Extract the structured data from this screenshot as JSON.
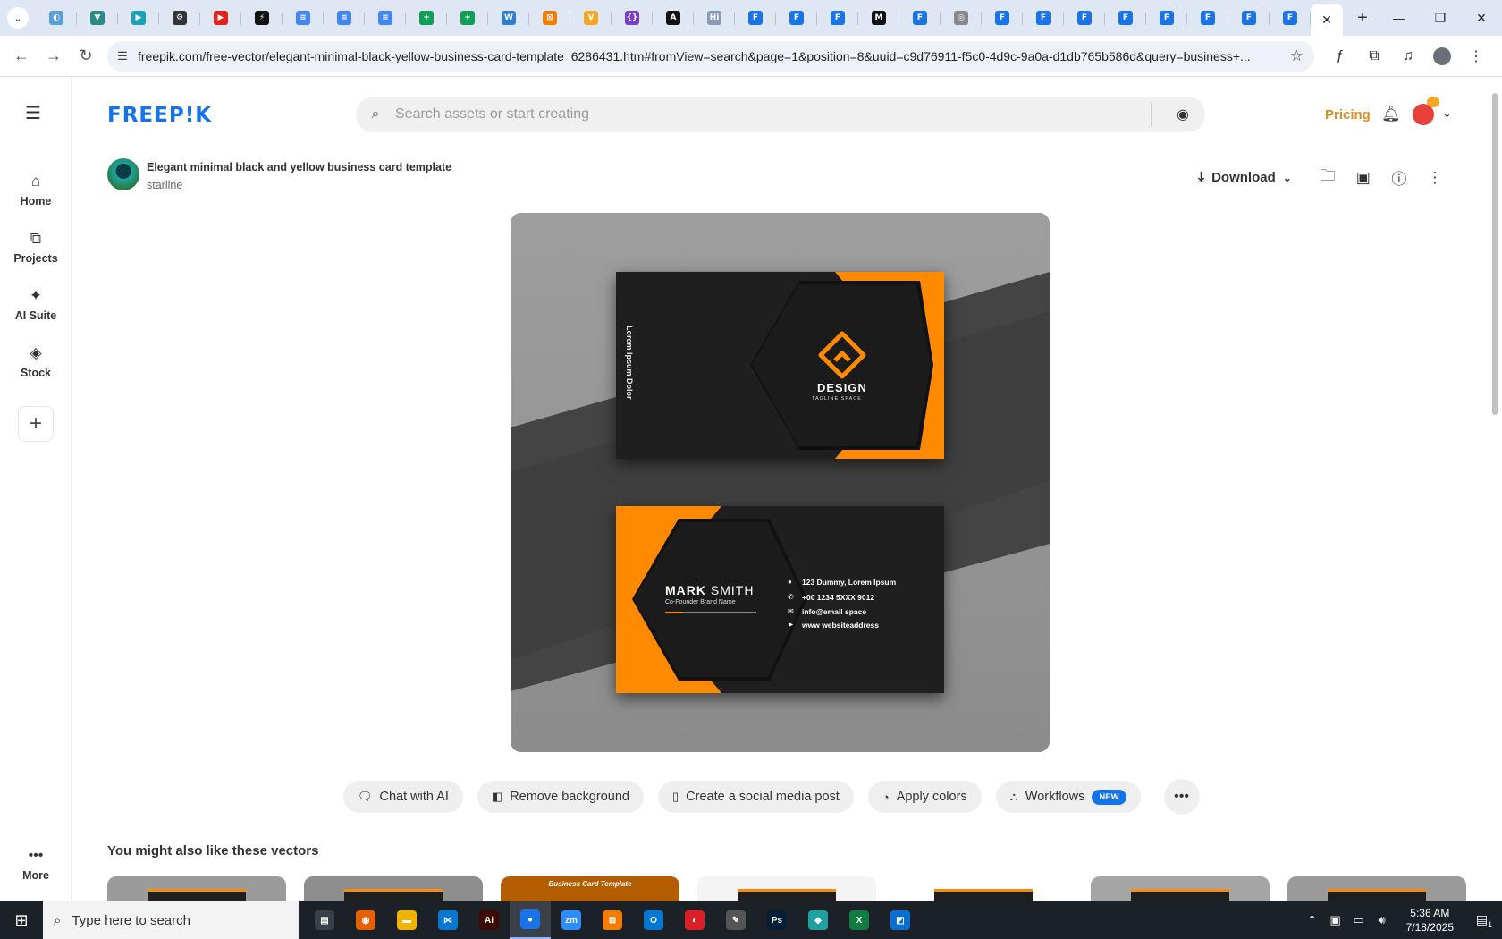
{
  "browser": {
    "tab_menu_icon": "chevron-down-icon",
    "tabs": [
      {
        "label": "",
        "color": "#5aa0d8",
        "glyph": "◐"
      },
      {
        "label": "",
        "color": "#2a8a86",
        "glyph": "▼"
      },
      {
        "label": "",
        "color": "#17a2b8",
        "glyph": "▶"
      },
      {
        "label": "",
        "color": "#333333",
        "glyph": "⚙"
      },
      {
        "label": "",
        "color": "#e62117",
        "glyph": "▶"
      },
      {
        "label": "",
        "color": "#111111",
        "glyph": "⚡"
      },
      {
        "label": "",
        "color": "#4285f4",
        "glyph": "≡"
      },
      {
        "label": "",
        "color": "#4285f4",
        "glyph": "≡"
      },
      {
        "label": "",
        "color": "#4285f4",
        "glyph": "≡"
      },
      {
        "label": "",
        "color": "#0f9d58",
        "glyph": "+"
      },
      {
        "label": "",
        "color": "#0f9d58",
        "glyph": "+"
      },
      {
        "label": "",
        "color": "#2b7cd3",
        "glyph": "W"
      },
      {
        "label": "",
        "color": "#f57c00",
        "glyph": "⊠"
      },
      {
        "label": "",
        "color": "#f5a623",
        "glyph": "V"
      },
      {
        "label": "",
        "color": "#7b3fc4",
        "glyph": "{}"
      },
      {
        "label": "",
        "color": "#111111",
        "glyph": "A"
      },
      {
        "label": "",
        "color": "#8a9bb5",
        "glyph": "Hi"
      },
      {
        "label": "",
        "color": "#1a73e8",
        "glyph": "F"
      },
      {
        "label": "",
        "color": "#1a73e8",
        "glyph": "F"
      },
      {
        "label": "",
        "color": "#1a73e8",
        "glyph": "F"
      },
      {
        "label": "",
        "color": "#111111",
        "glyph": "M"
      },
      {
        "label": "",
        "color": "#1a73e8",
        "glyph": "F"
      },
      {
        "label": "",
        "color": "#888888",
        "glyph": "◎"
      },
      {
        "label": "",
        "color": "#1a73e8",
        "glyph": "F"
      },
      {
        "label": "",
        "color": "#1a73e8",
        "glyph": "F"
      },
      {
        "label": "",
        "color": "#1a73e8",
        "glyph": "F"
      },
      {
        "label": "",
        "color": "#1a73e8",
        "glyph": "F"
      },
      {
        "label": "",
        "color": "#1a73e8",
        "glyph": "F"
      },
      {
        "label": "",
        "color": "#1a73e8",
        "glyph": "F"
      },
      {
        "label": "",
        "color": "#1a73e8",
        "glyph": "F"
      },
      {
        "label": "",
        "color": "#1a73e8",
        "glyph": "F"
      }
    ],
    "active_tab_close": "✕",
    "new_tab": "+",
    "window_controls": {
      "minimize": "—",
      "restore": "❐",
      "close": "✕"
    },
    "nav": {
      "back": "←",
      "forward": "→",
      "reload": "↻"
    },
    "url": "freepik.com/free-vector/elegant-minimal-black-yellow-business-card-template_6286431.htm#fromView=search&page=1&position=8&uuid=c9d76911-f5c0-4d9c-9a0a-d1db765b586d&query=business+...",
    "toolbar_icons": {
      "f": "ƒ",
      "ext": "⧉",
      "media": "♫",
      "menu": "⋮"
    }
  },
  "site": {
    "logo": "FREEP!K",
    "search_placeholder": "Search assets or start creating",
    "pricing": "Pricing",
    "sidebar": [
      {
        "label": "Home",
        "icon": "⌂"
      },
      {
        "label": "Projects",
        "icon": "⧉"
      },
      {
        "label": "AI Suite",
        "icon": "✦"
      },
      {
        "label": "Stock",
        "icon": "◈"
      }
    ],
    "sidebar_more": "More",
    "asset_title": "Elegant minimal black and yellow business card template",
    "asset_author": "starline",
    "download_label": "Download",
    "card_front": {
      "vertical_text": "Lorem Ipsum Dolor",
      "brand": "DESIGN",
      "tagline": "TAGLINE SPACE"
    },
    "card_back": {
      "first_name": "MARK",
      "last_name": " SMITH",
      "role": "Co-Founder Brand Name",
      "contacts": [
        "123 Dummy, Lorem Ipsum",
        "+00 1234 5XXX 9012",
        "info@email space",
        "www websiteaddress"
      ]
    },
    "pills": [
      {
        "label": "Chat with AI",
        "icon": "🗨"
      },
      {
        "label": "Remove background",
        "icon": "◧"
      },
      {
        "label": "Create a social media post",
        "icon": "▯"
      },
      {
        "label": "Apply colors",
        "icon": "◔"
      },
      {
        "label": "Workflows",
        "icon": "⛬",
        "badge": "NEW"
      }
    ],
    "also_like": "You might also like these vectors",
    "thumb_colors": [
      "#9b9b9b",
      "#8e8e8e",
      "#b35d00",
      "#f4f4f4",
      "#ffffff",
      "#a5a5a5",
      "#9a9a9a"
    ],
    "thumb_caption": "Business Card Template"
  },
  "taskbar": {
    "search_placeholder": "Type here to search",
    "apps": [
      {
        "glyph": "▤",
        "color": "#3a3f48"
      },
      {
        "glyph": "◉",
        "color": "#e66000"
      },
      {
        "glyph": "▬",
        "color": "#f0b400"
      },
      {
        "glyph": "⋈",
        "color": "#0078d4"
      },
      {
        "glyph": "Ai",
        "color": "#3b0a00"
      },
      {
        "glyph": "●",
        "color": "#1a73e8"
      },
      {
        "glyph": "zm",
        "color": "#2d8cff"
      },
      {
        "glyph": "⊠",
        "color": "#f57c00"
      },
      {
        "glyph": "O",
        "color": "#0078d4"
      },
      {
        "glyph": "◐",
        "color": "#da1f26"
      },
      {
        "glyph": "✎",
        "color": "#555555"
      },
      {
        "glyph": "Ps",
        "color": "#001e36"
      },
      {
        "glyph": "◆",
        "color": "#20a0a0"
      },
      {
        "glyph": "X",
        "color": "#107c41"
      },
      {
        "glyph": "◩",
        "color": "#0a6ed1"
      }
    ],
    "time": "5:36 AM",
    "date": "7/18/2025",
    "notif_count": "1"
  }
}
